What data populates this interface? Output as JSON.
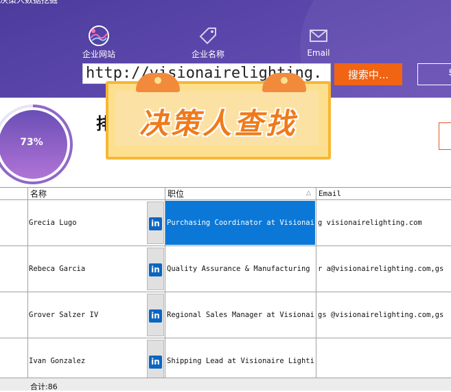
{
  "app": {
    "title": "决策人数据挖掘"
  },
  "nav": [
    {
      "label": "企业网站",
      "icon": "globe-icon"
    },
    {
      "label": "企业名称",
      "icon": "tag-icon"
    },
    {
      "label": "Email",
      "icon": "mail-icon"
    }
  ],
  "search": {
    "url_value": "http://visionairelighting.",
    "button_label": "搜索中...",
    "right_button_label": "导"
  },
  "progress": {
    "value_text": "73%",
    "value": 0.73
  },
  "overlay": {
    "title": "决策人查找"
  },
  "table": {
    "columns": [
      "名称",
      "职位",
      "Email"
    ],
    "rows": [
      {
        "name": "Grecia Lugo",
        "position": "Purchasing Coordinator at Visionaire",
        "email": "g       visionairelighting.com"
      },
      {
        "name": "Rebeca Garcia",
        "position": "Quality Assurance & Manufacturing Eng",
        "email": "r       a@visionairelighting.com,gs"
      },
      {
        "name": "Grover Salzer IV",
        "position": "Regional Sales Manager at Visionaire",
        "email": "gs      @visionairelighting.com,gs"
      },
      {
        "name": "Ivan Gonzalez",
        "position": "Shipping Lead at Visionaire Lighting",
        "email": ""
      }
    ],
    "linkedin_label": "in",
    "total_label": "合计:86"
  },
  "colors": {
    "header_bg": "#5a46aa",
    "accent": "#f06414",
    "selection": "#0b78d7",
    "linkedin": "#0b66c2"
  }
}
